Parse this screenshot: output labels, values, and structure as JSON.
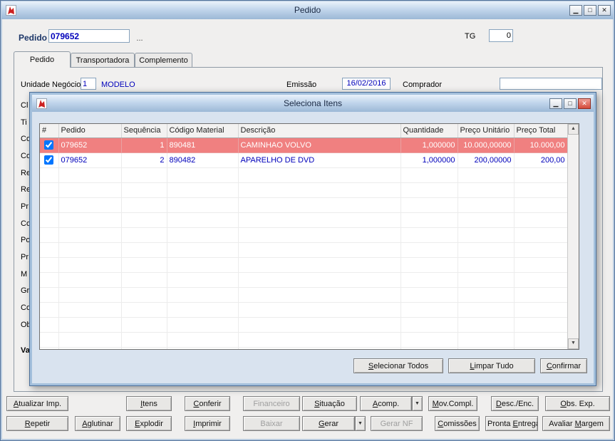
{
  "colors": {
    "selected_row_bg": "#f08080",
    "blue_text": "#0000bb"
  },
  "icons": {
    "minimize": "▁",
    "maximize": "□",
    "close": "✕",
    "dropdown": "▼",
    "scroll_up": "▲",
    "scroll_down": "▼"
  },
  "main_window": {
    "title": "Pedido",
    "header": {
      "pedido_label": "Pedido",
      "pedido_value": "079652",
      "lookup_label": "...",
      "tg_label": "TG",
      "tg_value": "0"
    },
    "tabs": [
      {
        "label": "Pedido",
        "active": true
      },
      {
        "label": "Transportadora",
        "active": false
      },
      {
        "label": "Complemento",
        "active": false
      }
    ],
    "form": {
      "unidade_negocio_label": "Unidade Negócio",
      "unidade_negocio_value": "1",
      "unidade_negocio_name": "MODELO",
      "emissao_label": "Emissão",
      "emissao_value": "16/02/2016",
      "comprador_label": "Comprador",
      "comprador_value": "",
      "left_label_fragments": [
        "Cl",
        "Ti",
        "Co",
        "Co",
        "Re",
        "Re",
        "Pr",
        "Co",
        "Po",
        "Pr",
        "M",
        "Gr",
        "Co",
        "Ob"
      ],
      "va_fragment": "Va"
    },
    "footer": {
      "row1": [
        {
          "label": "Atualizar Imp.",
          "enabled": true,
          "mnemonic": 0
        },
        {
          "label": "Itens",
          "enabled": true,
          "mnemonic": 0
        },
        {
          "label": "Conferir",
          "enabled": true,
          "mnemonic": 0
        },
        {
          "label": "Financeiro",
          "enabled": false,
          "mnemonic": null
        },
        {
          "label": "Situação",
          "enabled": true,
          "mnemonic": 0
        },
        {
          "label": "Acomp.",
          "enabled": true,
          "mnemonic": 0,
          "dropdown": true
        },
        {
          "label": "Mov.Compl.",
          "enabled": true,
          "mnemonic": 0
        },
        {
          "label": "Desc./Enc.",
          "enabled": true,
          "mnemonic": 0
        },
        {
          "label": "Obs. Exp.",
          "enabled": true,
          "mnemonic": 0
        }
      ],
      "row2": [
        {
          "label": "Repetir",
          "enabled": true,
          "mnemonic": 0
        },
        {
          "label": "Aglutinar",
          "enabled": true,
          "mnemonic": 0
        },
        {
          "label": "Explodir",
          "enabled": true,
          "mnemonic": 0
        },
        {
          "label": "Imprimir",
          "enabled": true,
          "mnemonic": 0
        },
        {
          "label": "Baixar",
          "enabled": false,
          "mnemonic": null
        },
        {
          "label": "Gerar",
          "enabled": true,
          "mnemonic": 0,
          "dropdown": true
        },
        {
          "label": "Gerar NF",
          "enabled": false,
          "mnemonic": null
        },
        {
          "label": "Comissões",
          "enabled": true,
          "mnemonic": 0
        },
        {
          "label": "Pronta Entrega",
          "enabled": true,
          "mnemonic": 7
        },
        {
          "label": "Avaliar Margem",
          "enabled": true,
          "mnemonic": 8
        }
      ]
    }
  },
  "modal": {
    "title": "Seleciona Itens",
    "table": {
      "columns": [
        "#",
        "Pedido",
        "Sequência",
        "Código Material",
        "Descrição",
        "Quantidade",
        "Preço Unitário",
        "Preço Total"
      ],
      "rows": [
        {
          "checked": true,
          "selected": true,
          "pedido": "079652",
          "sequencia": "1",
          "codigo_material": "890481",
          "descricao": "CAMINHAO VOLVO",
          "quantidade": "1,000000",
          "preco_unitario": "10.000,00000",
          "preco_total": "10.000,00"
        },
        {
          "checked": true,
          "selected": false,
          "pedido": "079652",
          "sequencia": "2",
          "codigo_material": "890482",
          "descricao": "APARELHO DE DVD",
          "quantidade": "1,000000",
          "preco_unitario": "200,00000",
          "preco_total": "200,00"
        }
      ]
    },
    "buttons": [
      {
        "label": "Selecionar Todos",
        "enabled": true,
        "mnemonic": 0
      },
      {
        "label": "Limpar Tudo",
        "enabled": true,
        "mnemonic": 0
      },
      {
        "label": "Confirmar",
        "enabled": true,
        "mnemonic": 0
      }
    ]
  }
}
